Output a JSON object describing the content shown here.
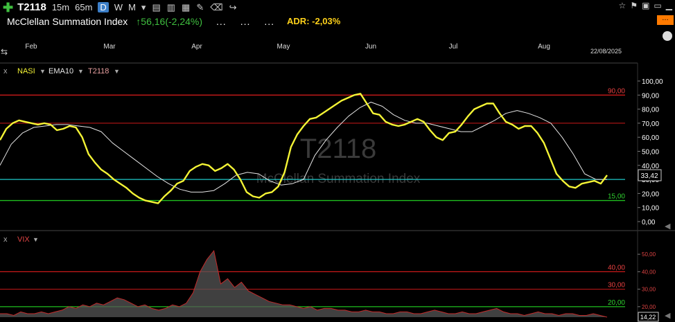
{
  "toolbar": {
    "ticker": "T2118",
    "timeframes": [
      "15m",
      "65m",
      "D",
      "W",
      "M"
    ],
    "selected_timeframe": "D"
  },
  "header": {
    "name": "McClellan Summation Index",
    "change": "↑56,16(-2,24%)",
    "dots": [
      "...",
      "...",
      "..."
    ],
    "adr": "ADR: -2,03%"
  },
  "watermark": {
    "symbol": "T2118",
    "name": "McClellan Summation Index"
  },
  "date_label": "22/08/2025",
  "colors": {
    "nasi": "#f4f435",
    "ema": "#e6e6e6",
    "line90": "#cc1a1a",
    "line70": "#a51414",
    "line30": "#1ec8c8",
    "line15": "#1fbf1f",
    "vix_fill": "#555555",
    "vix_line": "#c42a2a",
    "accent": "#ff7a00"
  },
  "chart_data": [
    {
      "type": "line",
      "x_labels": [
        "Feb",
        "Mar",
        "Apr",
        "May",
        "Jun",
        "Jul",
        "Aug"
      ],
      "legend": [
        "NASI",
        "EMA10",
        "T2118"
      ],
      "ylim": [
        0,
        100
      ],
      "yticks": [
        "100,00",
        "90,00",
        "80,00",
        "70,00",
        "60,00",
        "50,00",
        "40,00",
        "30,00",
        "20,00",
        "10,00",
        "0,00"
      ],
      "last_value": "33,42",
      "reference_lines": [
        {
          "value": 90,
          "label": "90,00"
        },
        {
          "value": 70,
          "label": ""
        },
        {
          "value": 30,
          "label": ""
        },
        {
          "value": 15,
          "label": "15,00"
        }
      ],
      "series": [
        {
          "name": "NASI",
          "values": [
            58,
            66,
            70,
            72,
            71,
            70,
            69,
            70,
            69,
            65,
            66,
            68,
            67,
            60,
            48,
            42,
            37,
            34,
            30,
            27,
            24,
            20,
            17,
            15,
            14,
            13,
            18,
            22,
            27,
            29,
            36,
            39,
            41,
            40,
            36,
            38,
            41,
            37,
            30,
            21,
            18,
            17,
            20,
            21,
            25,
            35,
            53,
            62,
            68,
            73,
            74,
            77,
            80,
            83,
            86,
            88,
            90,
            91,
            84,
            77,
            76,
            71,
            69,
            68,
            69,
            71,
            73,
            71,
            65,
            60,
            58,
            63,
            64,
            69,
            75,
            80,
            82,
            84,
            84,
            77,
            71,
            69,
            66,
            68,
            68,
            63,
            56,
            45,
            34,
            29,
            25,
            24,
            27,
            28,
            29,
            27,
            33
          ]
        },
        {
          "name": "EMA10",
          "values": [
            40,
            55,
            63,
            67,
            68,
            69,
            69,
            68,
            67,
            64,
            56,
            50,
            44,
            38,
            32,
            27,
            23,
            21,
            21,
            22,
            27,
            33,
            35,
            34,
            29,
            26,
            27,
            30,
            47,
            58,
            67,
            75,
            81,
            85,
            82,
            76,
            72,
            70,
            70,
            68,
            66,
            64,
            64,
            68,
            72,
            77,
            79,
            77,
            74,
            70,
            60,
            48,
            34,
            30,
            30
          ]
        }
      ]
    },
    {
      "type": "area",
      "legend": [
        "VIX"
      ],
      "ylim": [
        14,
        56
      ],
      "yticks": [
        "50,00",
        "40,00",
        "30,00",
        "20,00"
      ],
      "last_value": "14,22",
      "reference_lines": [
        {
          "value": 40,
          "label": "40,00"
        },
        {
          "value": 30,
          "label": "30,00"
        },
        {
          "value": 20,
          "label": "20,00"
        }
      ],
      "series": [
        {
          "name": "VIX",
          "values": [
            16,
            16,
            15,
            17,
            16,
            16,
            17,
            16,
            17,
            18,
            20,
            19,
            21,
            20,
            22,
            21,
            23,
            25,
            24,
            22,
            20,
            21,
            19,
            18,
            19,
            21,
            20,
            22,
            28,
            40,
            47,
            52,
            33,
            36,
            31,
            34,
            29,
            27,
            25,
            23,
            22,
            21,
            21,
            20,
            19,
            20,
            18,
            19,
            19,
            18,
            18,
            17,
            17,
            18,
            17,
            17,
            16,
            16,
            17,
            17,
            16,
            16,
            17,
            18,
            17,
            16,
            16,
            17,
            16,
            16,
            17,
            18,
            19,
            17,
            16,
            16,
            15,
            16,
            17,
            16,
            16,
            15,
            16,
            16,
            15,
            15,
            16,
            15,
            14
          ]
        }
      ]
    }
  ]
}
